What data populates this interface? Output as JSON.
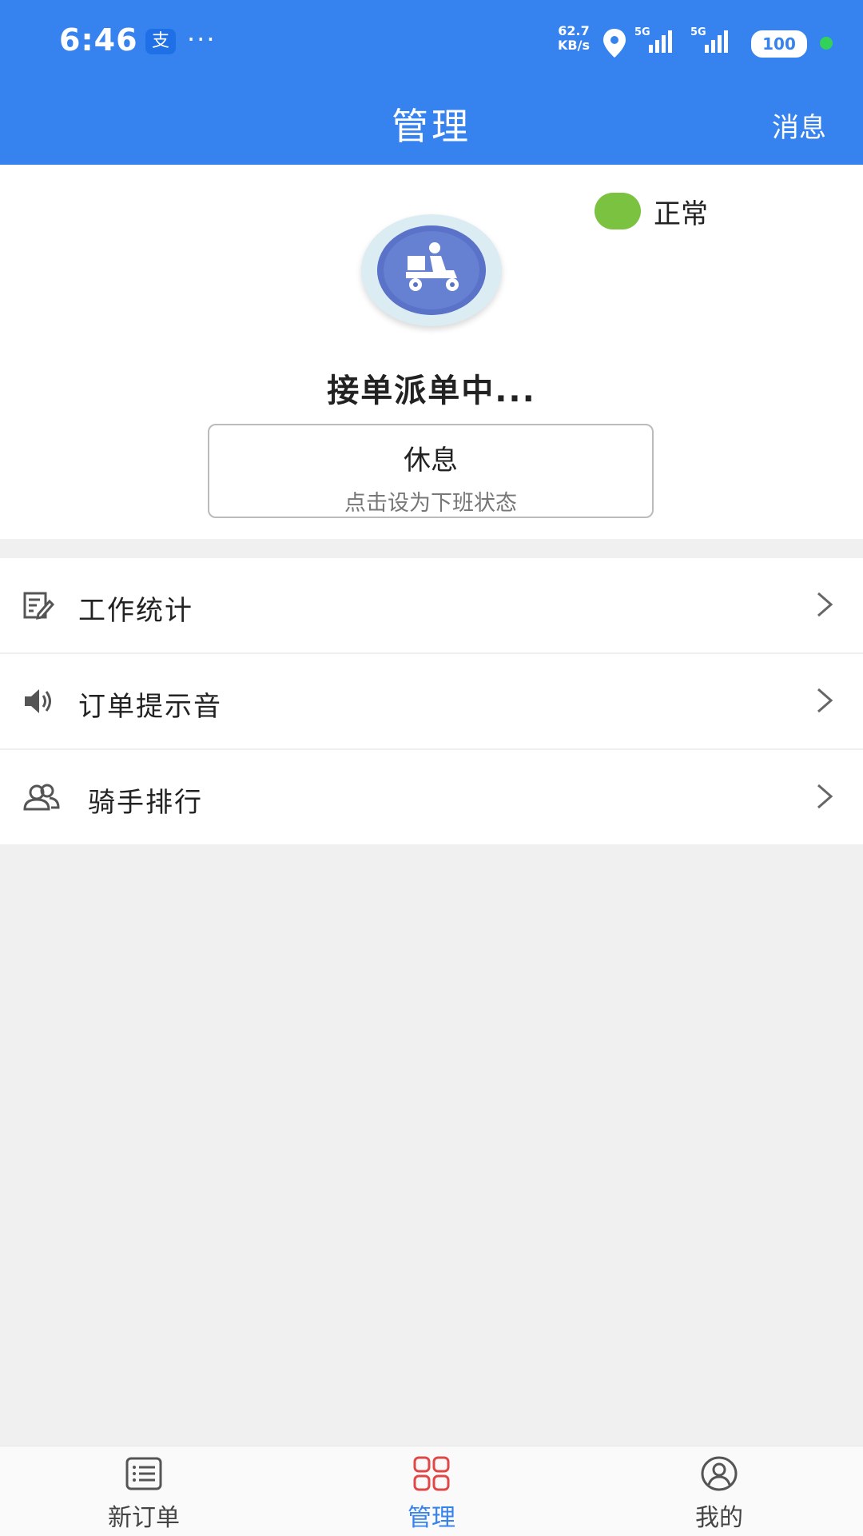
{
  "status_bar": {
    "time": "6:46",
    "net_speed_value": "62.7",
    "net_speed_unit": "KB/s",
    "signal_1": "5G",
    "signal_2": "5G",
    "battery": "100"
  },
  "header": {
    "title": "管理",
    "message_label": "消息"
  },
  "profile": {
    "status_text": "正常",
    "status_color": "#7bc241",
    "dispatch_text": "接单派单中...",
    "rest_button_label": "休息",
    "rest_button_sub": "点击设为下班状态"
  },
  "menu": {
    "items": [
      {
        "label": "工作统计",
        "icon": "edit-icon"
      },
      {
        "label": "订单提示音",
        "icon": "speaker-icon"
      },
      {
        "label": "骑手排行",
        "icon": "users-icon"
      }
    ]
  },
  "bottom_nav": {
    "tabs": [
      {
        "label": "新订单",
        "icon": "list-icon"
      },
      {
        "label": "管理",
        "icon": "grid-icon",
        "active": true
      },
      {
        "label": "我的",
        "icon": "user-icon"
      }
    ]
  },
  "colors": {
    "primary": "#3683f0",
    "status_green": "#7bc241",
    "active_tab_icon": "#e04848"
  }
}
